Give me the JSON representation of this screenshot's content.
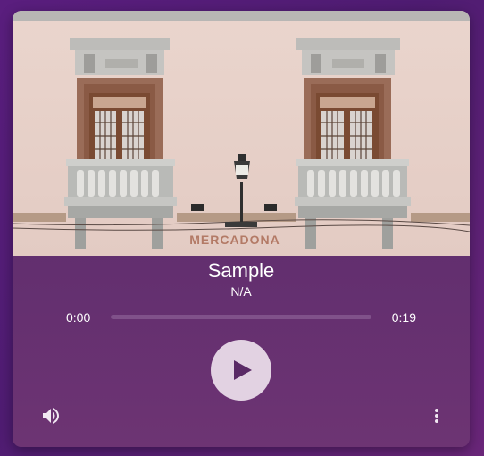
{
  "track": {
    "title": "Sample",
    "artist": "N/A",
    "artwork_icon": "building-facade-photo",
    "artwork_sign_text": "MERCADONA"
  },
  "progress": {
    "current_time": "0:00",
    "duration": "0:19",
    "fraction": 0.0
  },
  "controls": {
    "play_icon": "play-icon",
    "volume_icon": "volume-icon",
    "more_icon": "more-vertical-icon"
  },
  "colors": {
    "background": "#5a1e7e",
    "card": "#632f6f",
    "play_button": "#e2d2e2",
    "play_glyph": "#5a2a66",
    "progress_track": "#8c6c98",
    "text": "#ffffff"
  }
}
